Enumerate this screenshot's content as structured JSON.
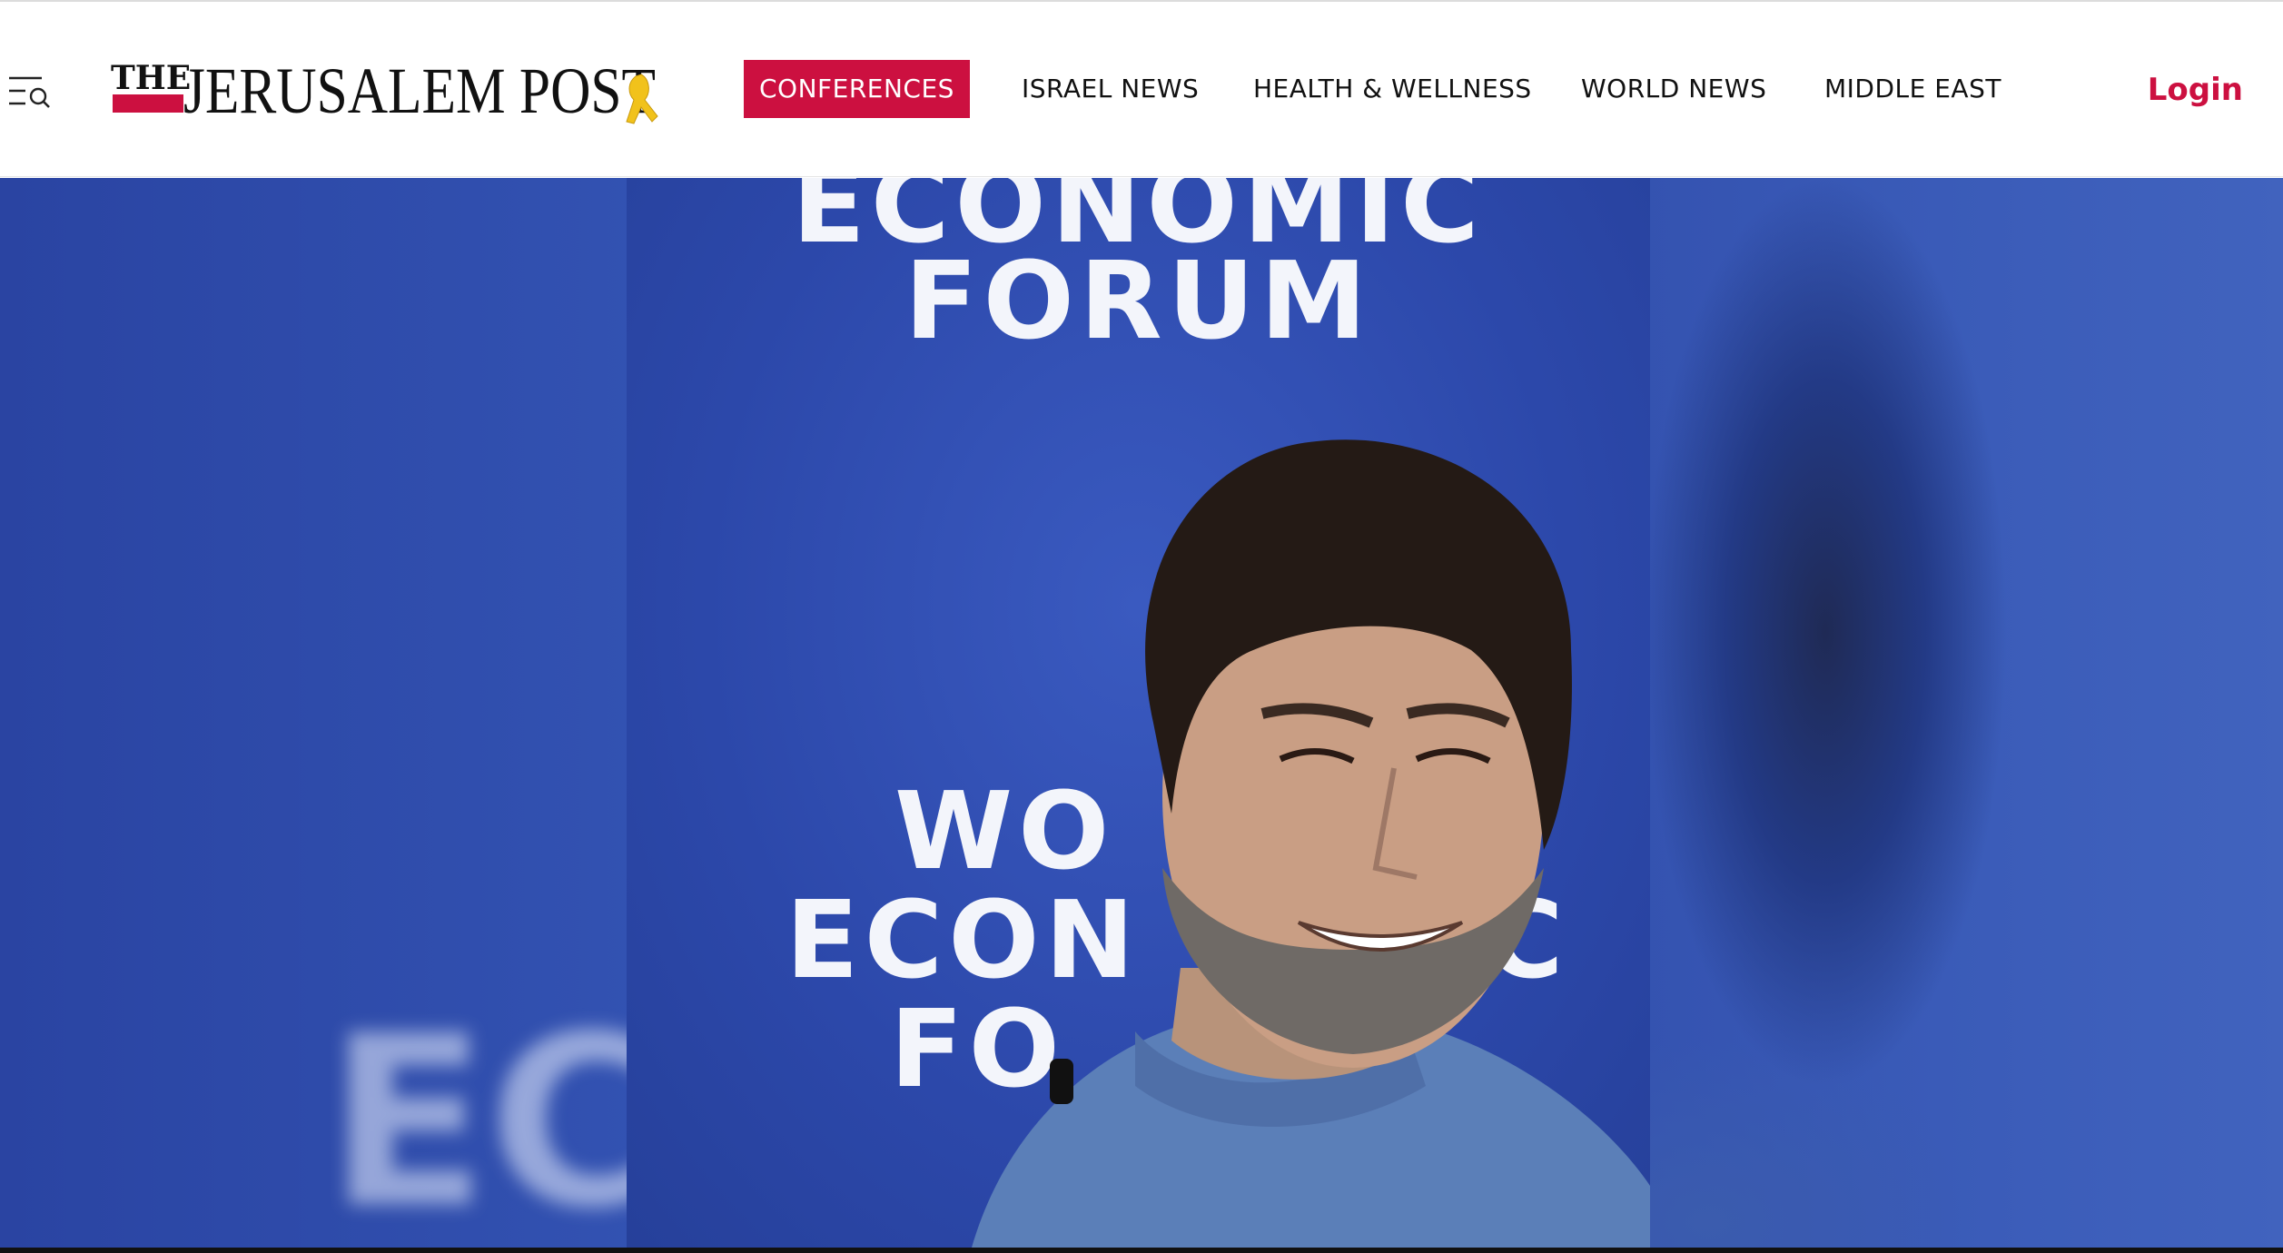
{
  "site": {
    "logo_text": "THE JERUSALEM POST",
    "logo_the": "THE",
    "logo_main": "JERUSALEM POST"
  },
  "header": {
    "menu_icon": "menu-search-icon",
    "nav": [
      {
        "label": "CONFERENCES",
        "active": true
      },
      {
        "label": "ISRAEL NEWS",
        "active": false
      },
      {
        "label": "HEALTH & WELLNESS",
        "active": false
      },
      {
        "label": "WORLD NEWS",
        "active": false
      },
      {
        "label": "MIDDLE EAST",
        "active": false
      }
    ],
    "login_label": "Login"
  },
  "hero": {
    "backdrop_top_line1": "ECONOMIC",
    "backdrop_top_line2": "FORUM",
    "backdrop_mid_line1": "WO",
    "backdrop_mid_line2": "ECON",
    "backdrop_mid_line2b": "C",
    "backdrop_mid_line3": "FO",
    "blur_left_text": "EC"
  },
  "colors": {
    "accent": "#cc1040",
    "backdrop_blue": "#2c48aa"
  }
}
